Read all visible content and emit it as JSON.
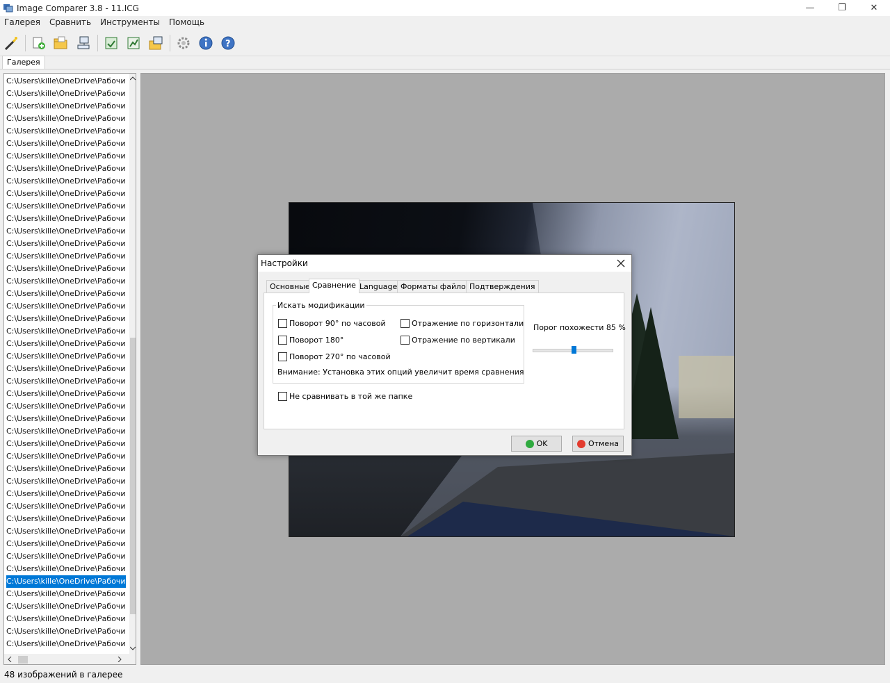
{
  "window": {
    "title": "Image Comparer 3.8 - 11.ICG",
    "minimize": "—",
    "maximize": "❐",
    "close": "✕"
  },
  "menu": [
    "Галерея",
    "Сравнить",
    "Инструменты",
    "Помощь"
  ],
  "tabs": {
    "gallery": "Галерея"
  },
  "file_list": {
    "item_text": "C:\\Users\\kille\\OneDrive\\Рабочий ст",
    "visible_count": 46,
    "selected_index": 40
  },
  "status": {
    "text": "48 изображений в галерее"
  },
  "dialog": {
    "title": "Настройки",
    "tabs": [
      "Основные",
      "Сравнение",
      "Language",
      "Форматы файлов",
      "Подтверждения"
    ],
    "active_tab": 1,
    "group_title": "Искать модификации",
    "checkboxes": [
      {
        "label": "Поворот 90° по часовой",
        "checked": false
      },
      {
        "label": "Отражение по горизонтали",
        "checked": false
      },
      {
        "label": "Поворот 180°",
        "checked": false
      },
      {
        "label": "Отражение по вертикали",
        "checked": false
      },
      {
        "label": "Поворот 270° по часовой",
        "checked": false
      }
    ],
    "warning": "Внимание: Установка этих опций увеличит время сравнения",
    "same_folder_checkbox": {
      "label": "Не сравнивать в той же папке",
      "checked": false
    },
    "threshold_label": "Порог похожести 85 %",
    "threshold_value": 85,
    "ok_label": "OK",
    "cancel_label": "Отмена"
  },
  "colors": {
    "selection": "#0078d7",
    "preview_bg": "#ababab",
    "ok_icon": "#2faa3f",
    "cancel_icon": "#e33b2e"
  }
}
